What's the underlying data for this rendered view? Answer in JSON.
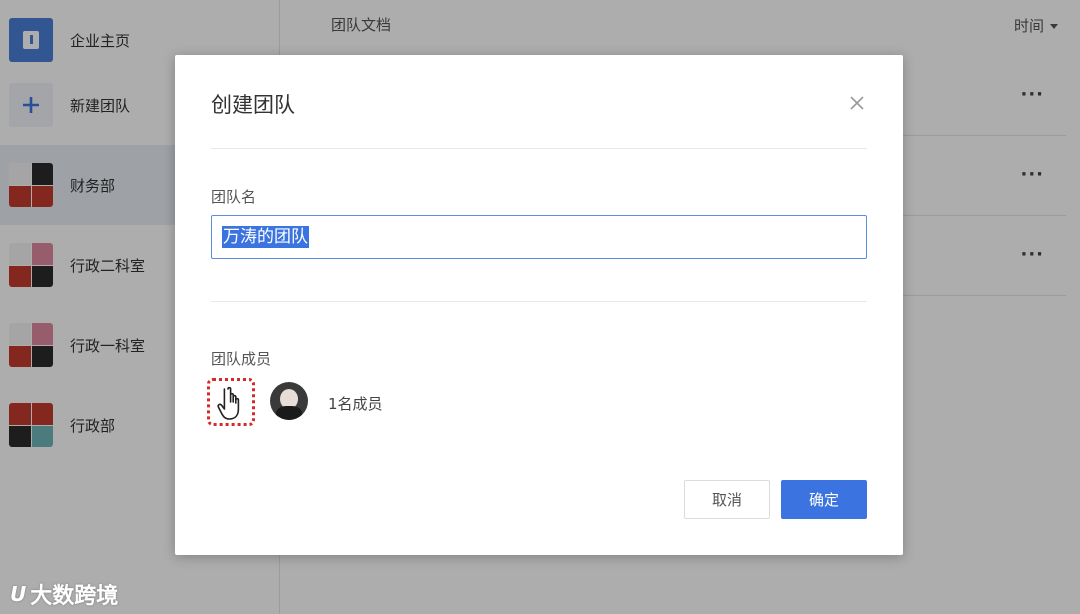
{
  "sidebar": {
    "items": [
      {
        "label": "企业主页",
        "icon": "home-icon"
      },
      {
        "label": "新建团队",
        "icon": "plus-icon"
      },
      {
        "label": "财务部",
        "icon": "team-avatar-mosaic"
      },
      {
        "label": "行政二科室",
        "icon": "team-avatar-mosaic"
      },
      {
        "label": "行政一科室",
        "icon": "team-avatar-mosaic"
      },
      {
        "label": "行政部",
        "icon": "team-avatar-mosaic"
      }
    ]
  },
  "main": {
    "title": "团队文档",
    "sort_label": "时间",
    "row_menu": "···"
  },
  "modal": {
    "title": "创建团队",
    "team_name_label": "团队名",
    "team_name_value": "万涛的团队",
    "members_label": "团队成员",
    "member_count": "1名成员",
    "cancel_label": "取消",
    "confirm_label": "确定"
  },
  "watermark": {
    "logo": "U",
    "text": "大数跨境"
  },
  "colors": {
    "primary": "#3b73e0",
    "overlay": "rgba(0,0,0,0.32)",
    "highlight_marker": "#d42a2a"
  }
}
